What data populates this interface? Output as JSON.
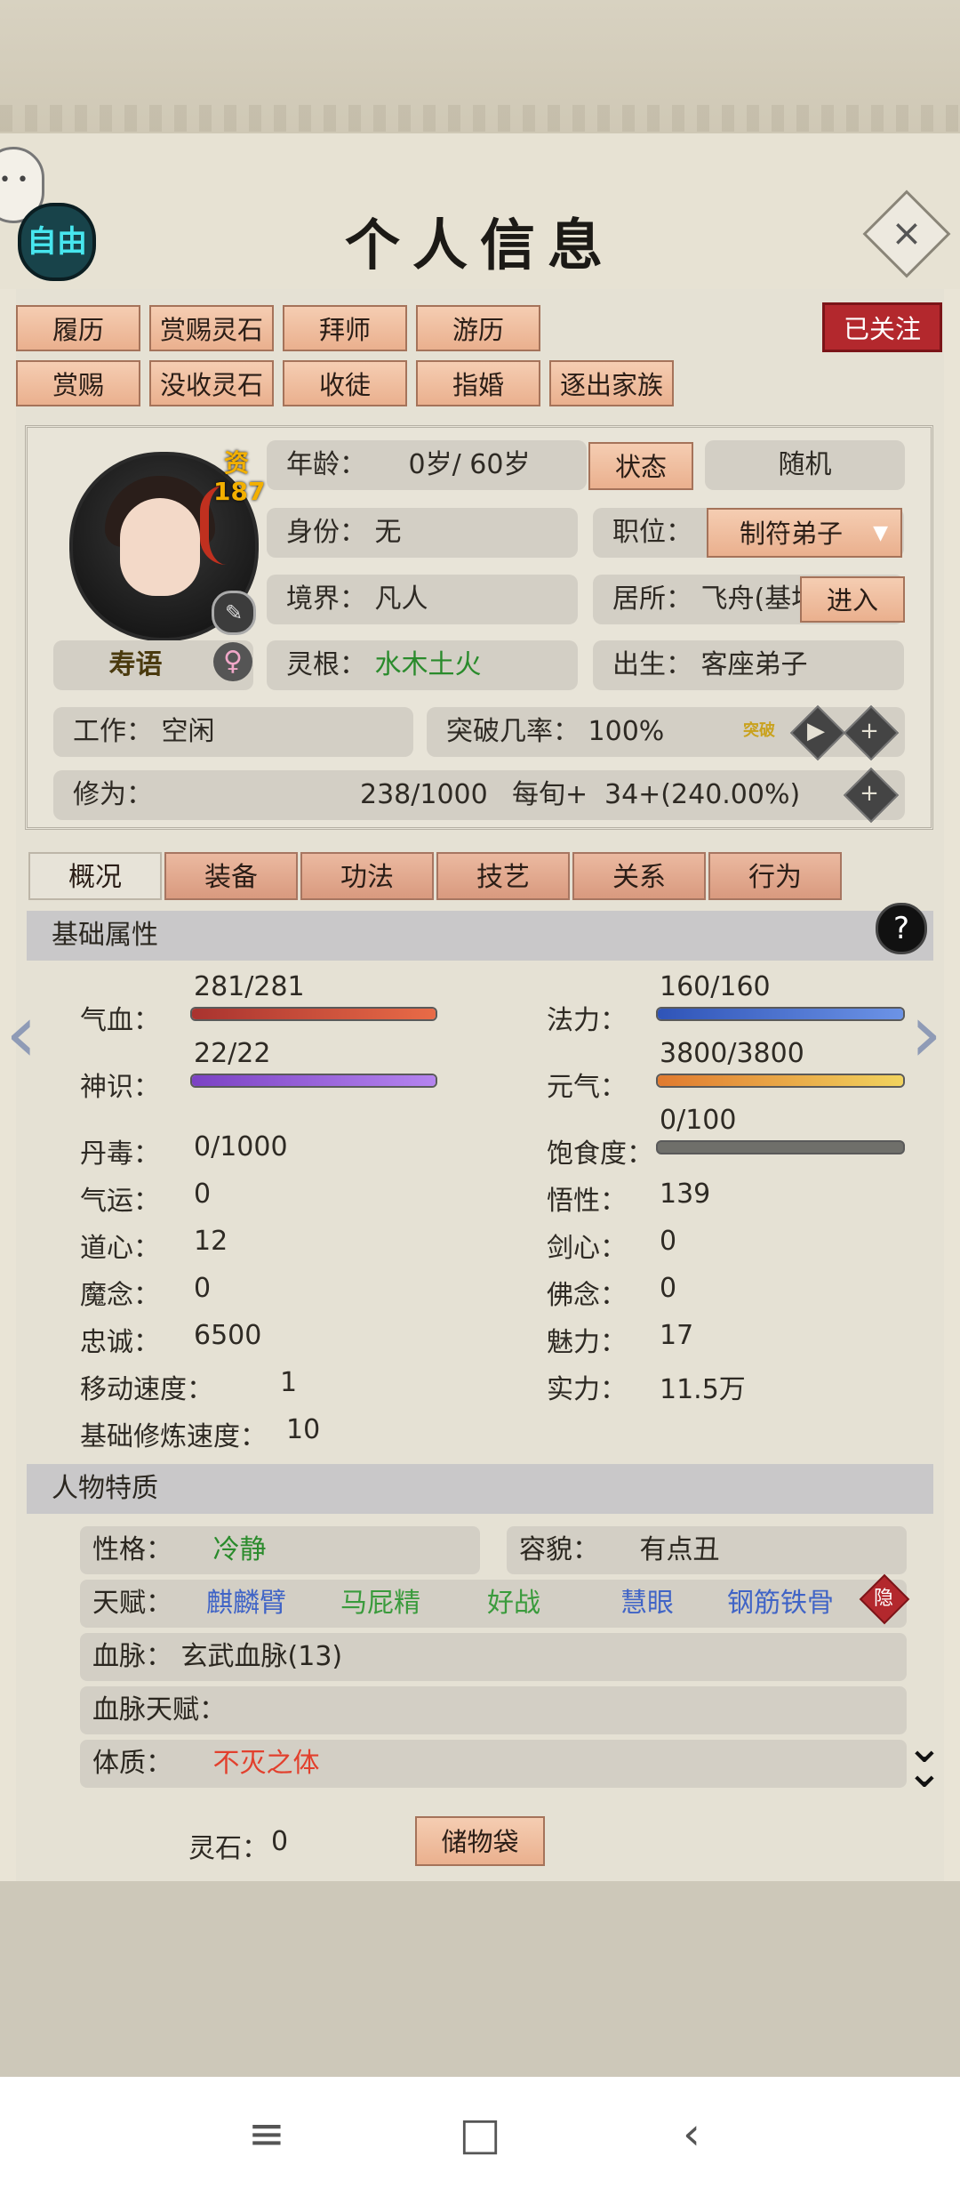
{
  "header": {
    "title": "个人信息",
    "free_badge": "自由",
    "close_icon": "×"
  },
  "action_buttons": {
    "row1": [
      "履历",
      "赏赐灵石",
      "拜师",
      "游历"
    ],
    "row2": [
      "赏赐",
      "没收灵石",
      "收徒",
      "指婚",
      "逐出家族"
    ],
    "follow": "已关注"
  },
  "profile": {
    "aptitude_label": "资",
    "aptitude_value": "187",
    "age_label": "年龄：",
    "age_value": "0岁/ 60岁",
    "status_button": "状态",
    "random_button": "随机",
    "identity_label": "身份：",
    "identity_value": "无",
    "position_label": "职位：",
    "position_value": "制符弟子",
    "realm_label": "境界：",
    "realm_value": "凡人",
    "residence_label": "居所：",
    "residence_value": "飞舟(基地",
    "enter_button": "进入",
    "lifespan_button": "寿语",
    "gender_icon": "♀",
    "root_label": "灵根：",
    "root_value": "水木土火",
    "birth_label": "出生：",
    "birth_value": "客座弟子",
    "work_label": "工作：",
    "work_value": "空闲",
    "breakthrough_label": "突破几率：",
    "breakthrough_value": "100%",
    "breakthrough_icon": "突破",
    "cultivation_label": "修为：",
    "cultivation_value": "238/1000",
    "per_turn_label": "每旬+",
    "per_turn_value": "34+(240.00%)"
  },
  "tabs": [
    "概况",
    "装备",
    "功法",
    "技艺",
    "关系",
    "行为"
  ],
  "basic": {
    "title": "基础属性",
    "help_icon": "?",
    "hp_label": "气血：",
    "hp_text": "281/281",
    "hp_fraction": 1.0,
    "mana_label": "法力：",
    "mana_text": "160/160",
    "mana_fraction": 1.0,
    "sense_label": "神识：",
    "sense_text": "22/22",
    "sense_fraction": 1.0,
    "qi_label": "元气：",
    "qi_text": "3800/3800",
    "qi_fraction": 1.0,
    "satiety_label": "饱食度：",
    "satiety_text": "0/100",
    "satiety_fraction": 0.0,
    "left_stats": [
      {
        "label": "丹毒：",
        "value": "0/1000"
      },
      {
        "label": "气运：",
        "value": "0"
      },
      {
        "label": "道心：",
        "value": "12"
      },
      {
        "label": "魔念：",
        "value": "0"
      },
      {
        "label": "忠诚：",
        "value": "6500"
      },
      {
        "label": "移动速度：",
        "value": "1"
      },
      {
        "label": "基础修炼速度：",
        "value": "10"
      }
    ],
    "right_stats": [
      {
        "label": "悟性：",
        "value": "139"
      },
      {
        "label": "剑心：",
        "value": "0"
      },
      {
        "label": "佛念：",
        "value": "0"
      },
      {
        "label": "魅力：",
        "value": "17"
      },
      {
        "label": "实力：",
        "value": "11.5万"
      }
    ]
  },
  "traits": {
    "title": "人物特质",
    "personality_label": "性格：",
    "personality_value": "冷静",
    "looks_label": "容貌：",
    "looks_value": "有点丑",
    "talent_label": "天赋：",
    "talents": [
      "麒麟臂",
      "马屁精",
      "好战",
      "慧眼",
      "钢筋铁骨"
    ],
    "hidden_badge": "隐",
    "bloodline_label": "血脉：",
    "bloodline_value": "玄武血脉(13)",
    "bloodline_talent_label": "血脉天赋：",
    "physique_label": "体质：",
    "physique_value": "不灭之体"
  },
  "footer": {
    "spirit_stone_label": "灵石：",
    "spirit_stone_value": "0",
    "storage_button": "储物袋"
  },
  "colors": {
    "hp": "#c9393a",
    "mana": "#3f66c9",
    "sense": "#9b60d6",
    "qi": "#e8a53d",
    "root": "#2a8b2c",
    "physique": "#e2402d",
    "talent_blue": "#4064c6",
    "talent_green": "#3a9b3c"
  }
}
